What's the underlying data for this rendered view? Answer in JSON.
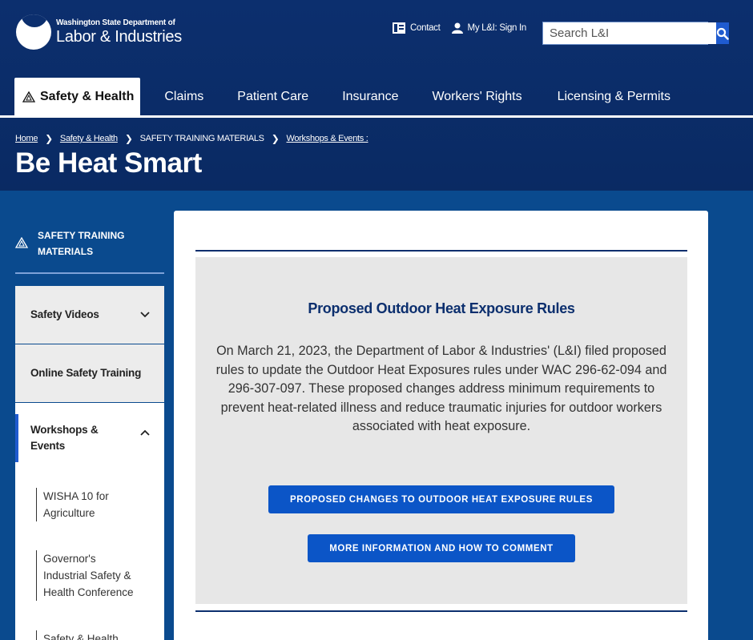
{
  "header": {
    "agency_small": "Washington State Department of",
    "agency_big": "Labor & Industries",
    "contact_label": "Contact",
    "signin_label": "My L&I: Sign In",
    "search_placeholder": "Search L&I"
  },
  "nav": {
    "items": [
      {
        "label": "Safety & Health"
      },
      {
        "label": "Claims"
      },
      {
        "label": "Patient Care"
      },
      {
        "label": "Insurance"
      },
      {
        "label": "Workers' Rights"
      },
      {
        "label": "Licensing & Permits"
      }
    ]
  },
  "breadcrumb": {
    "home": "Home",
    "safety": "Safety & Health",
    "training": "SAFETY TRAINING MATERIALS",
    "workshops": "Workshops & Events :"
  },
  "page": {
    "title": "Be Heat Smart"
  },
  "sidebar": {
    "heading": "SAFETY TRAINING MATERIALS",
    "items": [
      {
        "label": "Safety Videos"
      },
      {
        "label": "Online Safety Training"
      },
      {
        "label": "Workshops & Events"
      }
    ],
    "sub_items": [
      {
        "label": "WISHA 10 for Agriculture"
      },
      {
        "label": "Governor's Industrial Safety & Health Conference"
      },
      {
        "label": "Safety & Health"
      }
    ]
  },
  "callout": {
    "title": "Proposed Outdoor Heat Exposure Rules",
    "body": "On March 21, 2023, the Department of Labor & Industries' (L&I) filed proposed rules to update the Outdoor Heat Exposures rules under WAC 296-62-094 and 296-307-097. These proposed changes address minimum requirements to prevent heat-related illness and reduce traumatic injuries for outdoor workers associated with heat exposure.",
    "button1": "Proposed Changes to Outdoor Heat Exposure Rules",
    "button2": "More Information and How to Comment"
  },
  "colors": {
    "header_bg": "#0c2f6e",
    "page_bg": "#0a4a8e",
    "accent_blue": "#0b55c7"
  }
}
